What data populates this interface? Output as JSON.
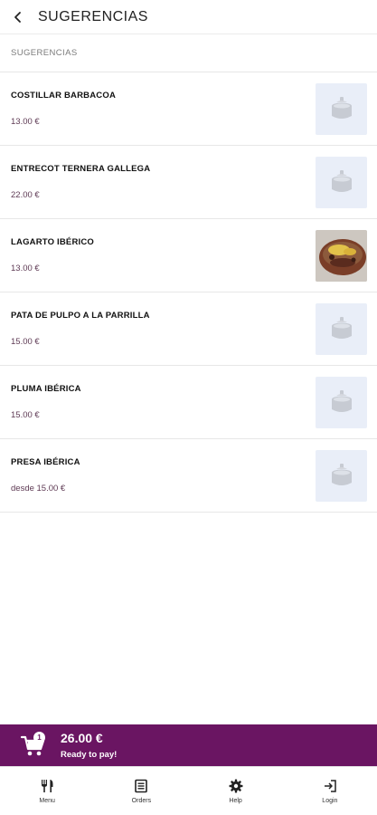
{
  "header": {
    "title": "SUGERENCIAS",
    "back_icon": "chevron-left-icon"
  },
  "section": {
    "label": "SUGERENCIAS"
  },
  "items": [
    {
      "name": "COSTILLAR BARBACOA",
      "price": "13.00 €",
      "image": "placeholder-dish"
    },
    {
      "name": "ENTRECOT TERNERA GALLEGA",
      "price": "22.00 €",
      "image": "placeholder-dish"
    },
    {
      "name": "LAGARTO IBÉRICO",
      "price": "13.00 €",
      "image": "photo"
    },
    {
      "name": "PATA DE PULPO A LA PARRILLA",
      "price": "15.00 €",
      "image": "placeholder-dish"
    },
    {
      "name": "PLUMA IBÉRICA",
      "price": "15.00 €",
      "image": "placeholder-dish"
    },
    {
      "name": "PRESA IBÉRICA",
      "price": "desde 15.00 €",
      "image": "placeholder-dish"
    }
  ],
  "cart": {
    "badge": "1",
    "total": "26.00 €",
    "status": "Ready to pay!",
    "color": "#6a1562"
  },
  "nav": [
    {
      "label": "Menu",
      "icon": "cutlery-icon"
    },
    {
      "label": "Orders",
      "icon": "receipt-icon"
    },
    {
      "label": "Help",
      "icon": "gear-icon"
    },
    {
      "label": "Login",
      "icon": "login-icon"
    }
  ]
}
